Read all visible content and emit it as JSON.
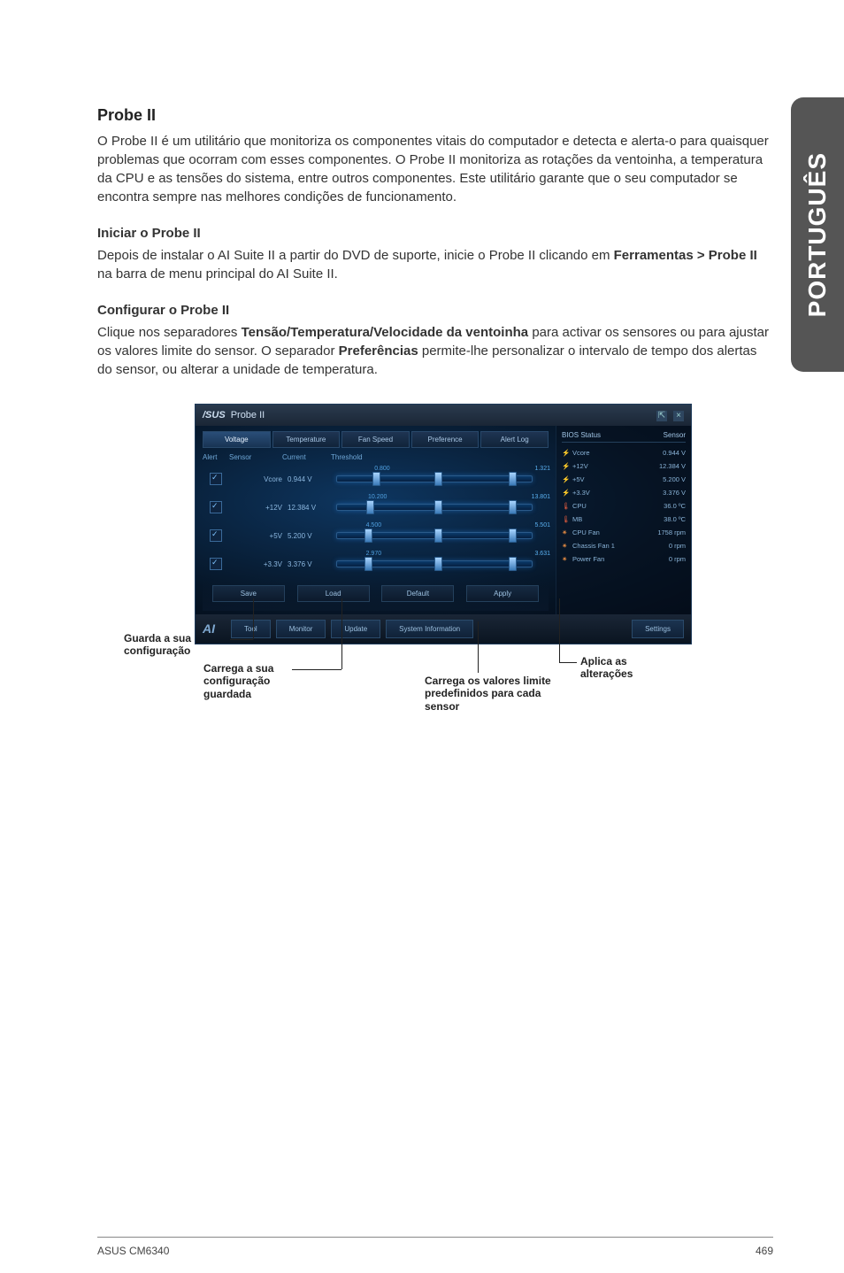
{
  "sidetab": "PORTUGUÊS",
  "sec1_title": "Probe II",
  "sec1_body": "O Probe II é um utilitário que monitoriza os componentes vitais do computador e detecta e alerta-o para quaisquer problemas que ocorram com esses componentes. O Probe II monitoriza as rotações da ventoinha, a temperatura da CPU e as tensões do sistema, entre outros componentes. Este utilitário garante que o seu computador se encontra sempre nas melhores condições de funcionamento.",
  "sub1_title": "Iniciar o Probe II",
  "sub1_body_pre": "Depois de instalar o AI Suite II a partir do DVD de suporte, inicie o Probe II clicando em ",
  "sub1_body_bold": "Ferramentas > Probe II",
  "sub1_body_post": " na barra de menu principal do AI Suite II.",
  "sub2_title": "Configurar o Probe II",
  "sub2_body_pre": "Clique nos separadores ",
  "sub2_body_bold1": "Tensão/Temperatura/Velocidade da ventoinha",
  "sub2_body_mid": " para activar os sensores ou para ajustar os valores limite do sensor. O separador ",
  "sub2_body_bold2": "Preferências",
  "sub2_body_post": " permite-lhe personalizar o intervalo de tempo dos alertas do sensor, ou alterar a unidade de temperatura.",
  "window": {
    "title": "Probe II",
    "brand": "/SUS",
    "tabs": [
      "Voltage",
      "Temperature",
      "Fan Speed",
      "Preference",
      "Alert Log"
    ],
    "head": [
      "Alert",
      "Sensor",
      "Current",
      "Threshold"
    ],
    "rows": [
      {
        "name": "Vcore",
        "val": "0.944 V",
        "low": "0.800",
        "high": "1.321",
        "nub1": 18,
        "nub2": 88
      },
      {
        "name": "+12V",
        "val": "12.384 V",
        "low": "10.200",
        "high": "13.801",
        "nub1": 15,
        "nub2": 88
      },
      {
        "name": "+5V",
        "val": "5.200 V",
        "low": "4.500",
        "high": "5.501",
        "nub1": 14,
        "nub2": 88
      },
      {
        "name": "+3.3V",
        "val": "3.376 V",
        "low": "2.970",
        "high": "3.631",
        "nub1": 14,
        "nub2": 88
      }
    ],
    "bottom": [
      "Save",
      "Load",
      "Default",
      "Apply"
    ],
    "footer": [
      "Tool",
      "Monitor",
      "Update",
      "System Information",
      "Settings"
    ],
    "status_head": [
      "BIOS Status",
      "Sensor"
    ],
    "status": [
      {
        "ic": "⚡",
        "cls": "ic-v",
        "name": "Vcore",
        "val": "0.944 V"
      },
      {
        "ic": "⚡",
        "cls": "ic-v",
        "name": "+12V",
        "val": "12.384 V"
      },
      {
        "ic": "⚡",
        "cls": "ic-v",
        "name": "+5V",
        "val": "5.200 V"
      },
      {
        "ic": "⚡",
        "cls": "ic-v",
        "name": "+3.3V",
        "val": "3.376 V"
      },
      {
        "ic": "🌡",
        "cls": "ic-t",
        "name": "CPU",
        "val": "36.0 ºC"
      },
      {
        "ic": "🌡",
        "cls": "ic-t",
        "name": "MB",
        "val": "38.0 ºC"
      },
      {
        "ic": "✷",
        "cls": "ic-f",
        "name": "CPU Fan",
        "val": "1758 rpm"
      },
      {
        "ic": "✷",
        "cls": "ic-f",
        "name": "Chassis Fan 1",
        "val": "0 rpm"
      },
      {
        "ic": "✷",
        "cls": "ic-f",
        "name": "Power Fan",
        "val": "0 rpm"
      }
    ]
  },
  "callouts": {
    "save": "Guarda a sua configuração",
    "load": "Carrega a sua configuração guardada",
    "default": "Carrega os valores limite predefinidos para cada sensor",
    "apply": "Aplica as alterações"
  },
  "footer_left": "ASUS CM6340",
  "footer_right": "469"
}
